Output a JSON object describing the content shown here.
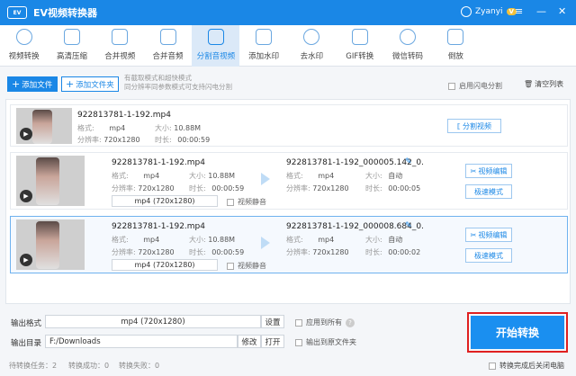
{
  "app": {
    "title": "EV视频转换器",
    "logo_text": "EV",
    "user": "Zyanyi",
    "vip": "V",
    "window": {
      "menu": "≡",
      "minimize": "—",
      "close": "✕"
    }
  },
  "toolbar": {
    "items": [
      {
        "label": "视频转换",
        "icon": "video-convert-icon"
      },
      {
        "label": "高清压缩",
        "icon": "compress-icon"
      },
      {
        "label": "合并视频",
        "icon": "merge-video-icon"
      },
      {
        "label": "合并音频",
        "icon": "merge-audio-icon"
      },
      {
        "label": "分割音视频",
        "icon": "split-icon"
      },
      {
        "label": "添加水印",
        "icon": "stamp-icon"
      },
      {
        "label": "去水印",
        "icon": "drop-icon"
      },
      {
        "label": "GIF转换",
        "icon": "gif-icon"
      },
      {
        "label": "微信转码",
        "icon": "wechat-icon"
      },
      {
        "label": "倒放",
        "icon": "reverse-play-icon"
      }
    ],
    "active_index": 4
  },
  "actions": {
    "add_file": "添加文件",
    "add_folder": "添加文件夹",
    "hint_line1": "有截取模式和超快模式",
    "hint_line2": "同分辨率同参数模式可支持闪电分割",
    "lightning": "启用闪电分割",
    "clear_list": "清空列表"
  },
  "labels": {
    "format": "格式:",
    "size": "大小:",
    "resolution": "分辨率:",
    "duration": "时长:",
    "mute": "视频静音",
    "split_video": "分割视频",
    "video_edit": "视频编辑",
    "fast_mode": "极速模式"
  },
  "files": [
    {
      "name": "922813781-1-192.mp4",
      "format": "mp4",
      "size": "10.88M",
      "resolution": "720x1280",
      "duration": "00:00:59"
    },
    {
      "name": "922813781-1-192.mp4",
      "format": "mp4",
      "size": "10.88M",
      "resolution": "720x1280",
      "duration": "00:00:59",
      "output_format": "mp4 (720x1280)",
      "out_name": "922813781-1-192_000005.142_0.",
      "out_format": "mp4",
      "out_size": "自动",
      "out_resolution": "720x1280",
      "out_duration": "00:00:05"
    },
    {
      "name": "922813781-1-192.mp4",
      "format": "mp4",
      "size": "10.88M",
      "resolution": "720x1280",
      "duration": "00:00:59",
      "output_format": "mp4 (720x1280)",
      "out_name": "922813781-1-192_000008.684_0.",
      "out_format": "mp4",
      "out_size": "自动",
      "out_resolution": "720x1280",
      "out_duration": "00:00:02"
    }
  ],
  "output": {
    "format_label": "输出格式",
    "format_value": "mp4 (720x1280)",
    "settings": "设置",
    "apply_all": "应用到所有",
    "help": "?",
    "dir_label": "输出目录",
    "dir_value": "F:/Downloads",
    "modify": "修改",
    "open": "打开",
    "to_source": "输出到原文件夹",
    "start": "开始转换"
  },
  "status": {
    "tasks": "待转换任务：2",
    "success": "转换成功：0",
    "fail": "转换失败：0",
    "shutdown": "转换完成后关闭电脑"
  },
  "colors": {
    "accent": "#1a87e6",
    "highlight": "#e02020"
  }
}
